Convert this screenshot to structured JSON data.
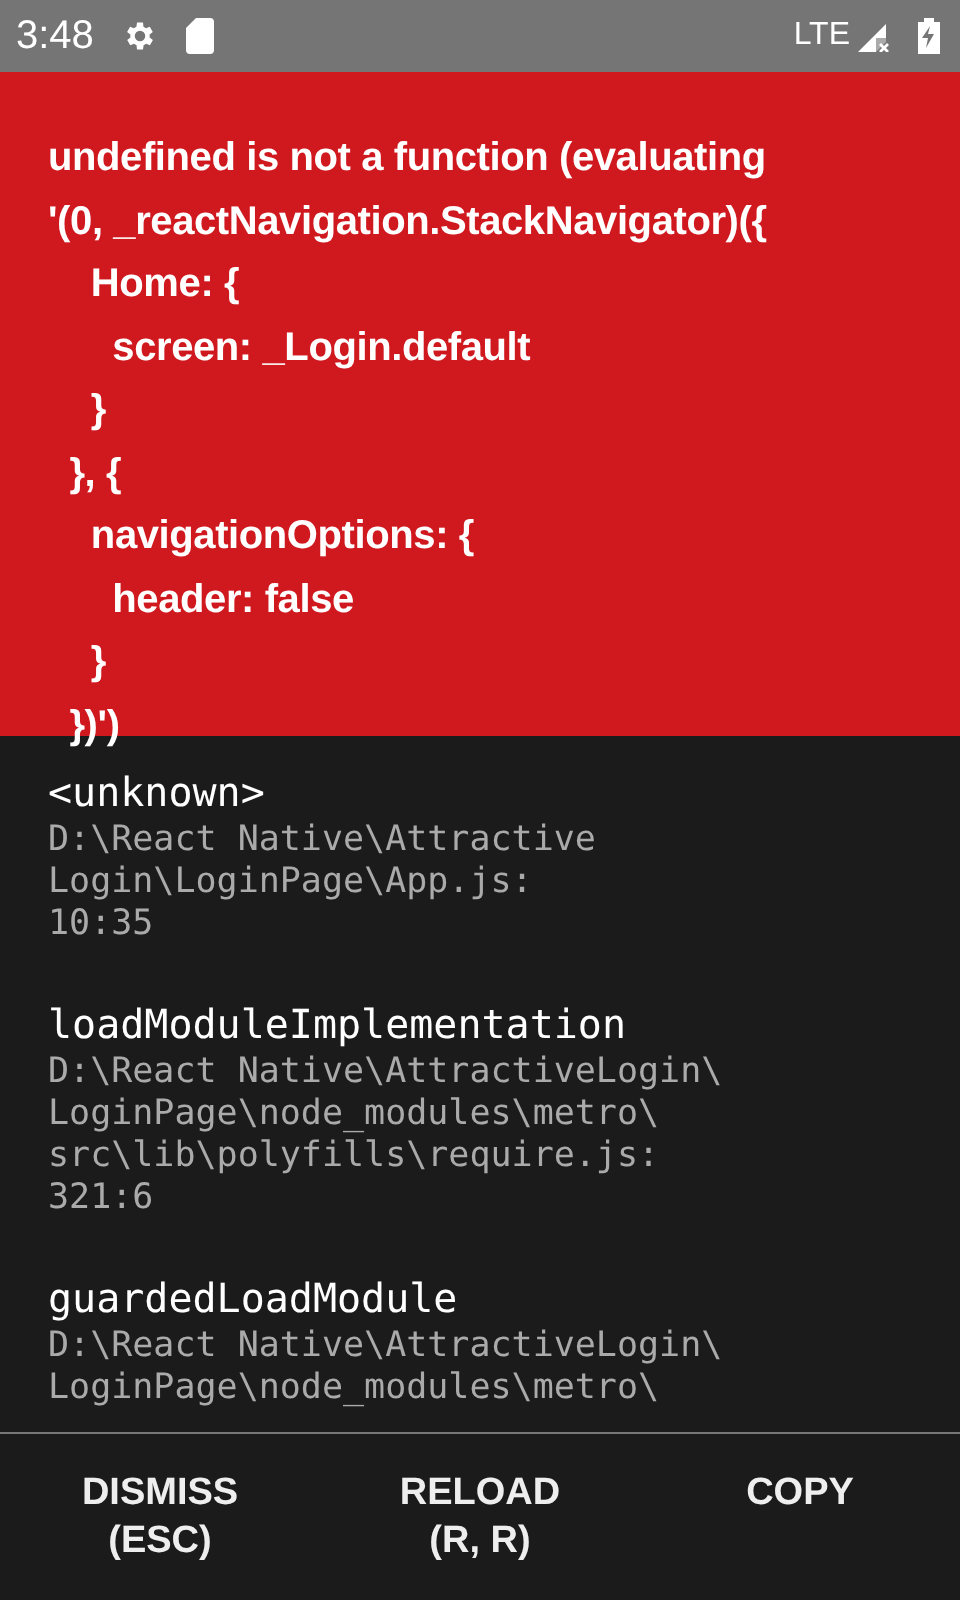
{
  "status_bar": {
    "time": "3:48",
    "network": "LTE"
  },
  "error": {
    "message": "undefined is not a function (evaluating\n'(0, _reactNavigation.StackNavigator)({\n    Home: {\n      screen: _Login.default\n    }\n  }, {\n    navigationOptions: {\n      header: false\n    }\n  })')"
  },
  "stack_frames": [
    {
      "method": "<unknown>",
      "location_lines": [
        "D:\\React Native\\Attractive",
        "Login\\LoginPage\\App.js:",
        "10:35"
      ]
    },
    {
      "method": "loadModuleImplementation",
      "location_lines": [
        "D:\\React Native\\AttractiveLogin\\",
        "LoginPage\\node_modules\\metro\\",
        "src\\lib\\polyfills\\require.js:",
        "321:6"
      ]
    },
    {
      "method": "guardedLoadModule",
      "location_lines": [
        "D:\\React Native\\AttractiveLogin\\",
        "LoginPage\\node_modules\\metro\\"
      ]
    }
  ],
  "buttons": [
    {
      "label": "DISMISS\n(ESC)"
    },
    {
      "label": "RELOAD\n(R, R)"
    },
    {
      "label": "COPY"
    }
  ]
}
